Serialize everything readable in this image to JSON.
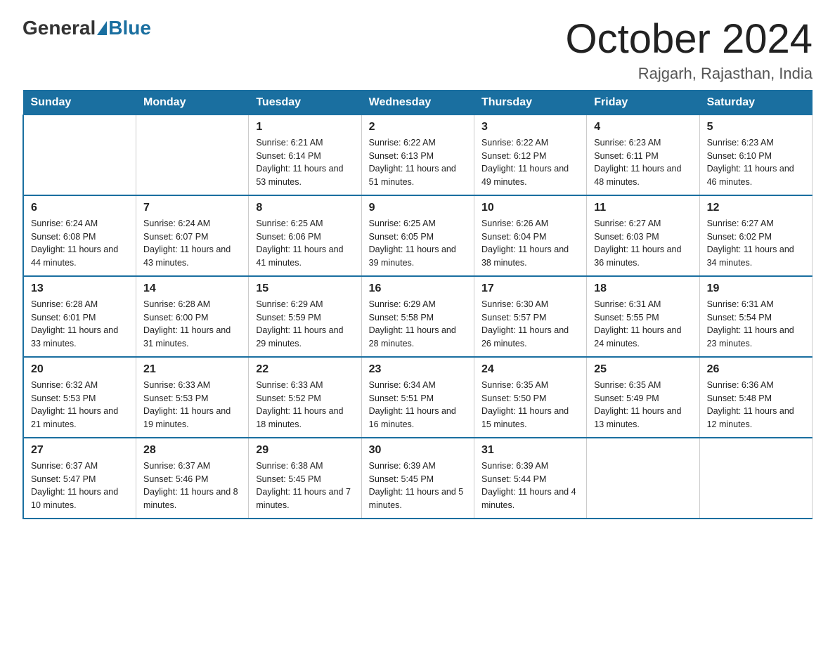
{
  "logo": {
    "general": "General",
    "blue": "Blue"
  },
  "title": "October 2024",
  "subtitle": "Rajgarh, Rajasthan, India",
  "headers": [
    "Sunday",
    "Monday",
    "Tuesday",
    "Wednesday",
    "Thursday",
    "Friday",
    "Saturday"
  ],
  "weeks": [
    [
      {
        "day": "",
        "sunrise": "",
        "sunset": "",
        "daylight": ""
      },
      {
        "day": "",
        "sunrise": "",
        "sunset": "",
        "daylight": ""
      },
      {
        "day": "1",
        "sunrise": "Sunrise: 6:21 AM",
        "sunset": "Sunset: 6:14 PM",
        "daylight": "Daylight: 11 hours and 53 minutes."
      },
      {
        "day": "2",
        "sunrise": "Sunrise: 6:22 AM",
        "sunset": "Sunset: 6:13 PM",
        "daylight": "Daylight: 11 hours and 51 minutes."
      },
      {
        "day": "3",
        "sunrise": "Sunrise: 6:22 AM",
        "sunset": "Sunset: 6:12 PM",
        "daylight": "Daylight: 11 hours and 49 minutes."
      },
      {
        "day": "4",
        "sunrise": "Sunrise: 6:23 AM",
        "sunset": "Sunset: 6:11 PM",
        "daylight": "Daylight: 11 hours and 48 minutes."
      },
      {
        "day": "5",
        "sunrise": "Sunrise: 6:23 AM",
        "sunset": "Sunset: 6:10 PM",
        "daylight": "Daylight: 11 hours and 46 minutes."
      }
    ],
    [
      {
        "day": "6",
        "sunrise": "Sunrise: 6:24 AM",
        "sunset": "Sunset: 6:08 PM",
        "daylight": "Daylight: 11 hours and 44 minutes."
      },
      {
        "day": "7",
        "sunrise": "Sunrise: 6:24 AM",
        "sunset": "Sunset: 6:07 PM",
        "daylight": "Daylight: 11 hours and 43 minutes."
      },
      {
        "day": "8",
        "sunrise": "Sunrise: 6:25 AM",
        "sunset": "Sunset: 6:06 PM",
        "daylight": "Daylight: 11 hours and 41 minutes."
      },
      {
        "day": "9",
        "sunrise": "Sunrise: 6:25 AM",
        "sunset": "Sunset: 6:05 PM",
        "daylight": "Daylight: 11 hours and 39 minutes."
      },
      {
        "day": "10",
        "sunrise": "Sunrise: 6:26 AM",
        "sunset": "Sunset: 6:04 PM",
        "daylight": "Daylight: 11 hours and 38 minutes."
      },
      {
        "day": "11",
        "sunrise": "Sunrise: 6:27 AM",
        "sunset": "Sunset: 6:03 PM",
        "daylight": "Daylight: 11 hours and 36 minutes."
      },
      {
        "day": "12",
        "sunrise": "Sunrise: 6:27 AM",
        "sunset": "Sunset: 6:02 PM",
        "daylight": "Daylight: 11 hours and 34 minutes."
      }
    ],
    [
      {
        "day": "13",
        "sunrise": "Sunrise: 6:28 AM",
        "sunset": "Sunset: 6:01 PM",
        "daylight": "Daylight: 11 hours and 33 minutes."
      },
      {
        "day": "14",
        "sunrise": "Sunrise: 6:28 AM",
        "sunset": "Sunset: 6:00 PM",
        "daylight": "Daylight: 11 hours and 31 minutes."
      },
      {
        "day": "15",
        "sunrise": "Sunrise: 6:29 AM",
        "sunset": "Sunset: 5:59 PM",
        "daylight": "Daylight: 11 hours and 29 minutes."
      },
      {
        "day": "16",
        "sunrise": "Sunrise: 6:29 AM",
        "sunset": "Sunset: 5:58 PM",
        "daylight": "Daylight: 11 hours and 28 minutes."
      },
      {
        "day": "17",
        "sunrise": "Sunrise: 6:30 AM",
        "sunset": "Sunset: 5:57 PM",
        "daylight": "Daylight: 11 hours and 26 minutes."
      },
      {
        "day": "18",
        "sunrise": "Sunrise: 6:31 AM",
        "sunset": "Sunset: 5:55 PM",
        "daylight": "Daylight: 11 hours and 24 minutes."
      },
      {
        "day": "19",
        "sunrise": "Sunrise: 6:31 AM",
        "sunset": "Sunset: 5:54 PM",
        "daylight": "Daylight: 11 hours and 23 minutes."
      }
    ],
    [
      {
        "day": "20",
        "sunrise": "Sunrise: 6:32 AM",
        "sunset": "Sunset: 5:53 PM",
        "daylight": "Daylight: 11 hours and 21 minutes."
      },
      {
        "day": "21",
        "sunrise": "Sunrise: 6:33 AM",
        "sunset": "Sunset: 5:53 PM",
        "daylight": "Daylight: 11 hours and 19 minutes."
      },
      {
        "day": "22",
        "sunrise": "Sunrise: 6:33 AM",
        "sunset": "Sunset: 5:52 PM",
        "daylight": "Daylight: 11 hours and 18 minutes."
      },
      {
        "day": "23",
        "sunrise": "Sunrise: 6:34 AM",
        "sunset": "Sunset: 5:51 PM",
        "daylight": "Daylight: 11 hours and 16 minutes."
      },
      {
        "day": "24",
        "sunrise": "Sunrise: 6:35 AM",
        "sunset": "Sunset: 5:50 PM",
        "daylight": "Daylight: 11 hours and 15 minutes."
      },
      {
        "day": "25",
        "sunrise": "Sunrise: 6:35 AM",
        "sunset": "Sunset: 5:49 PM",
        "daylight": "Daylight: 11 hours and 13 minutes."
      },
      {
        "day": "26",
        "sunrise": "Sunrise: 6:36 AM",
        "sunset": "Sunset: 5:48 PM",
        "daylight": "Daylight: 11 hours and 12 minutes."
      }
    ],
    [
      {
        "day": "27",
        "sunrise": "Sunrise: 6:37 AM",
        "sunset": "Sunset: 5:47 PM",
        "daylight": "Daylight: 11 hours and 10 minutes."
      },
      {
        "day": "28",
        "sunrise": "Sunrise: 6:37 AM",
        "sunset": "Sunset: 5:46 PM",
        "daylight": "Daylight: 11 hours and 8 minutes."
      },
      {
        "day": "29",
        "sunrise": "Sunrise: 6:38 AM",
        "sunset": "Sunset: 5:45 PM",
        "daylight": "Daylight: 11 hours and 7 minutes."
      },
      {
        "day": "30",
        "sunrise": "Sunrise: 6:39 AM",
        "sunset": "Sunset: 5:45 PM",
        "daylight": "Daylight: 11 hours and 5 minutes."
      },
      {
        "day": "31",
        "sunrise": "Sunrise: 6:39 AM",
        "sunset": "Sunset: 5:44 PM",
        "daylight": "Daylight: 11 hours and 4 minutes."
      },
      {
        "day": "",
        "sunrise": "",
        "sunset": "",
        "daylight": ""
      },
      {
        "day": "",
        "sunrise": "",
        "sunset": "",
        "daylight": ""
      }
    ]
  ]
}
